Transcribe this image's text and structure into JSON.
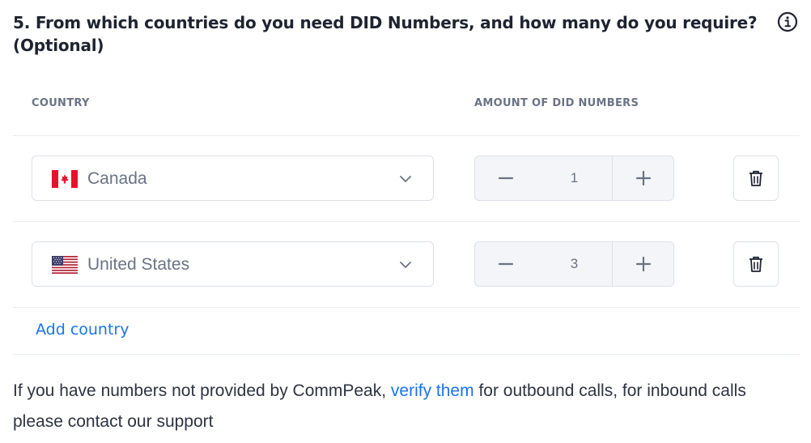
{
  "question": {
    "title": "5. From which countries do you need DID Numbers, and how many do you require? (Optional)"
  },
  "icons": {
    "info": "info-circle-icon",
    "chevron": "chevron-down-icon",
    "minus": "minus-icon",
    "plus": "plus-icon",
    "trash": "trash-icon"
  },
  "table": {
    "col_country": "COUNTRY",
    "col_amount": "AMOUNT OF DID NUMBERS",
    "rows": [
      {
        "country": "Canada",
        "flag": "canada-flag-icon",
        "amount": "1"
      },
      {
        "country": "United States",
        "flag": "us-flag-icon",
        "amount": "3"
      }
    ]
  },
  "add_country_label": "Add country",
  "note": {
    "before": "If you have numbers not provided by CommPeak, ",
    "link": "verify them",
    "after": " for outbound calls, for inbound calls please contact our support"
  },
  "colors": {
    "accent": "#1a73e8",
    "text": "#1e2330",
    "muted": "#6a7384",
    "border": "#dde1e8"
  }
}
